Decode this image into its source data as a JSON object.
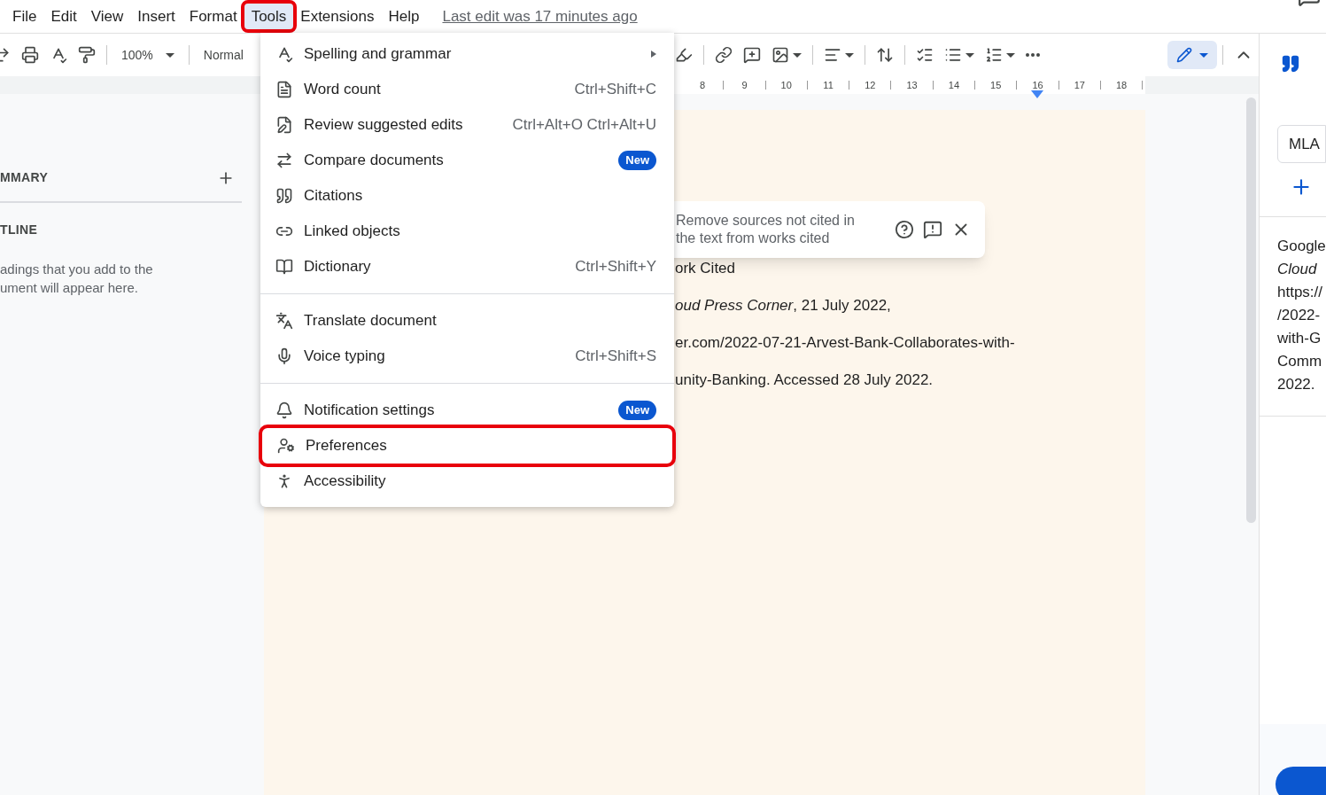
{
  "menubar": {
    "items": [
      {
        "label": "File",
        "selected": false,
        "highlighted": false
      },
      {
        "label": "Edit",
        "selected": false,
        "highlighted": false
      },
      {
        "label": "View",
        "selected": false,
        "highlighted": false
      },
      {
        "label": "Insert",
        "selected": false,
        "highlighted": false
      },
      {
        "label": "Format",
        "selected": false,
        "highlighted": false
      },
      {
        "label": "Tools",
        "selected": true,
        "highlighted": true
      },
      {
        "label": "Extensions",
        "selected": false,
        "highlighted": false
      },
      {
        "label": "Help",
        "selected": false,
        "highlighted": false
      }
    ],
    "last_edit": "Last edit was 17 minutes ago"
  },
  "toolbar": {
    "zoom": "100%",
    "style": "Normal",
    "edit_mode_selected": true
  },
  "ruler": {
    "numbers": [
      "8",
      "9",
      "10",
      "11",
      "12",
      "13",
      "14",
      "15",
      "16",
      "17",
      "18"
    ]
  },
  "sidebar": {
    "summary_heading": "MMARY",
    "outline_heading": "TLINE",
    "outline_hint": "adings that you add to the\nument will appear here."
  },
  "document": {
    "lines": [
      "ork Cited",
      "*oud Press Corner*, 21 July 2022,",
      "er.com/2022-07-21-Arvest-Bank-Collaborates-with-",
      "unity-Banking. Accessed 28 July 2022."
    ]
  },
  "popup": {
    "text": "Remove sources not cited in\nthe text from works cited"
  },
  "tools_menu": {
    "items": [
      {
        "kind": "item",
        "label": "Spelling and grammar",
        "submenu": true,
        "highlighted": false
      },
      {
        "kind": "item",
        "label": "Word count",
        "shortcut": "Ctrl+Shift+C",
        "highlighted": false
      },
      {
        "kind": "item",
        "label": "Review suggested edits",
        "shortcut": "Ctrl+Alt+O Ctrl+Alt+U",
        "highlighted": false
      },
      {
        "kind": "item",
        "label": "Compare documents",
        "badge": "New",
        "highlighted": false
      },
      {
        "kind": "item",
        "label": "Citations",
        "highlighted": false
      },
      {
        "kind": "item",
        "label": "Linked objects",
        "highlighted": false
      },
      {
        "kind": "item",
        "label": "Dictionary",
        "shortcut": "Ctrl+Shift+Y",
        "highlighted": false
      },
      {
        "kind": "divider"
      },
      {
        "kind": "item",
        "label": "Translate document",
        "highlighted": false
      },
      {
        "kind": "item",
        "label": "Voice typing",
        "shortcut": "Ctrl+Shift+S",
        "highlighted": false
      },
      {
        "kind": "divider"
      },
      {
        "kind": "item",
        "label": "Notification settings",
        "badge": "New",
        "highlighted": false
      },
      {
        "kind": "item",
        "label": "Preferences",
        "highlighted": true
      },
      {
        "kind": "item",
        "label": "Accessibility",
        "highlighted": false
      }
    ]
  },
  "citations_panel": {
    "style_field": "MLA",
    "card_lines": [
      {
        "text": "Google",
        "italic": false
      },
      {
        "text": "Cloud",
        "italic": true
      },
      {
        "text": "https://",
        "italic": false
      },
      {
        "text": "/2022-",
        "italic": false
      },
      {
        "text": "with-G",
        "italic": false
      },
      {
        "text": "Comm",
        "italic": false
      },
      {
        "text": "2022.",
        "italic": false
      }
    ]
  }
}
